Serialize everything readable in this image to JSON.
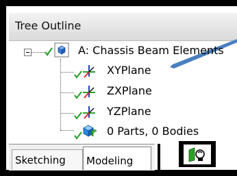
{
  "panel": {
    "title": "Tree Outline"
  },
  "tree": {
    "root": {
      "label": "A: Chassis Beam Elements"
    },
    "children": [
      {
        "label": "XYPlane",
        "icon": "plane-axes-icon"
      },
      {
        "label": "ZXPlane",
        "icon": "plane-axes-icon"
      },
      {
        "label": "YZPlane",
        "icon": "plane-axes-icon"
      },
      {
        "label": "0 Parts, 0 Bodies",
        "icon": "bodies-icon"
      }
    ]
  },
  "tabs": {
    "sketching": "Sketching",
    "modeling": "Modeling",
    "active": "Modeling"
  },
  "colors": {
    "callout_arrow": "#4a7fbf",
    "check_green": "#2ca02c",
    "axis_x": "#d62728",
    "axis_y": "#2ca02c",
    "axis_z": "#1f3fbf",
    "cube_blue": "#1e6fd9"
  }
}
